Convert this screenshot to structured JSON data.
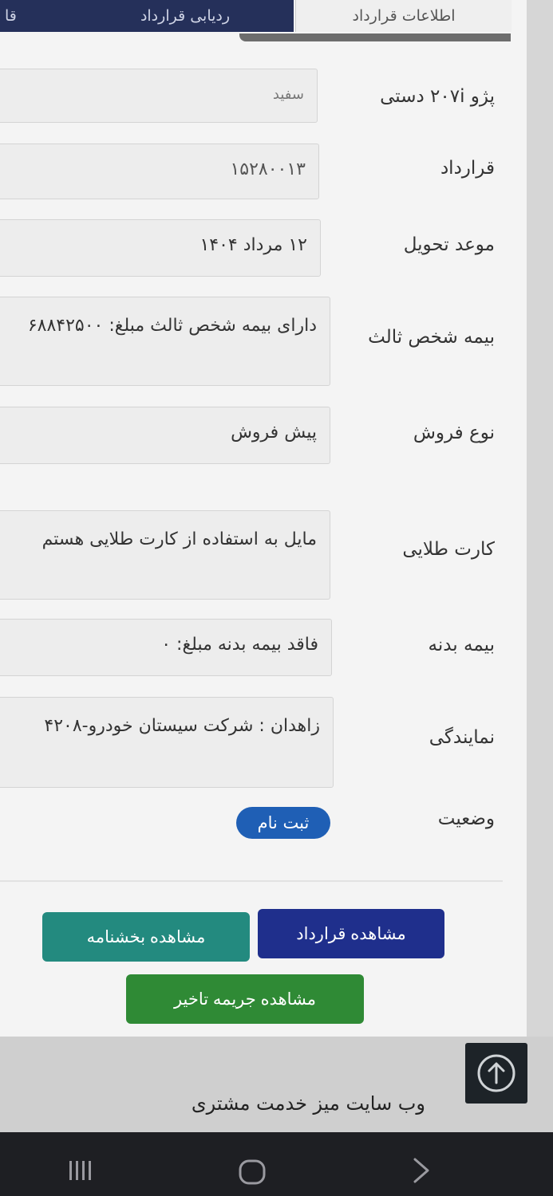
{
  "tabs": [
    {
      "label": "اطلاعات قرارداد"
    },
    {
      "label": "ردیابی قرارداد"
    },
    {
      "label": "قا"
    }
  ],
  "rows": [
    {
      "label": "پژو ۲۰۷i دستی",
      "value": "سفید"
    },
    {
      "label": "قرارداد",
      "value": "۱۵۲۸۰۰۱۳"
    },
    {
      "label": "موعد تحویل",
      "value": "۱۲ مرداد ۱۴۰۴"
    },
    {
      "label": "بیمه شخص ثالث",
      "value": "دارای بیمه شخص ثالث مبلغ: ۶۸۸۴۲۵۰۰"
    },
    {
      "label": "نوع فروش",
      "value": "پیش فروش"
    },
    {
      "label": "کارت طلایی",
      "value": "مایل به استفاده از کارت طلایی هستم"
    },
    {
      "label": "بیمه بدنه",
      "value": "فاقد بیمه بدنه مبلغ: ۰"
    },
    {
      "label": "نمایندگی",
      "value": "زاهدان : شرکت سیستان خودرو-۴۲۰۸"
    }
  ],
  "status": {
    "label": "وضعیت",
    "value": "ثبت نام",
    "color": "#1f5fb5"
  },
  "buttons": {
    "view_contract": "مشاهده قرارداد",
    "view_circular": "مشاهده بخشنامه",
    "view_penalty": "مشاهده جریمه تاخیر"
  },
  "footer": {
    "text": "وب سایت میز خدمت مشتری"
  },
  "icons": {
    "scroll_top": "arrow-up-circle-icon"
  }
}
